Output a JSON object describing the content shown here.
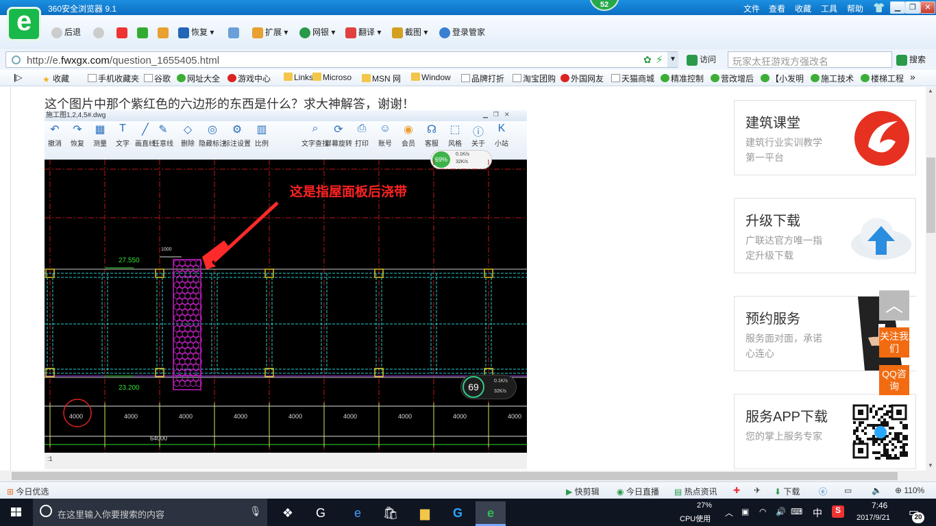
{
  "browser": {
    "title": "360安全浏览器 9.1",
    "tab_badge": "52",
    "menu": [
      "文件",
      "查看",
      "收藏",
      "工具",
      "帮助"
    ],
    "toolbar": {
      "back": "后退",
      "restore": "恢复",
      "extend": "扩展",
      "bank": "网银",
      "translate": "翻译",
      "screenshot": "截图",
      "login": "登录管家"
    },
    "address": {
      "url_prefix": "http://e.",
      "url_domain": "fwxgx.com",
      "url_path": "/question_1655405.html",
      "visit": "访问",
      "search_placeholder": "玩家太狂游戏方强改名",
      "search_btn": "搜索"
    },
    "favorites": [
      "收藏",
      "手机收藏夹",
      "谷歌",
      "网址大全",
      "游戏中心",
      "Links",
      "Microso",
      "MSN 网",
      "Window",
      "品牌打折",
      "淘宝团购",
      "外国网友",
      "天猫商城",
      "精准控制",
      "营改增后",
      "【小发明",
      "施工技术",
      "楼梯工程"
    ]
  },
  "page": {
    "question": "这个图片中那个紫红色的六边形的东西是什么？求大神解答，谢谢！",
    "cad": {
      "window_title": "施工图1,2,4,5#.dwg",
      "tools": [
        "撤消",
        "恢复",
        "测量",
        "文字",
        "画直线",
        "任意线",
        "删除",
        "隐藏标注",
        "标注设置",
        "比例",
        "文字查找",
        "屏幕旋转",
        "打印",
        "账号",
        "会员",
        "客服",
        "风格",
        "关于",
        "小站"
      ],
      "annotation": "这是指屋面板后浇带",
      "elev_top": "27.550",
      "elev_bottom": "23.200",
      "dim_small": "1000",
      "spans": [
        "4000",
        "4000",
        "4000",
        "4000",
        "4000",
        "4000",
        "4000",
        "4000",
        "4000"
      ],
      "total_span": "64000",
      "net_percent_top": "69%",
      "net_up_top": "0.1K/s",
      "net_down_top": "32K/s",
      "net_percent": "69",
      "net_up": "0.1K/s",
      "net_down": "32K/s",
      "status": ":1"
    },
    "sidebar": [
      {
        "title": "建筑课堂",
        "desc": "建筑行业实训教学第一平台"
      },
      {
        "title": "升级下载",
        "desc": "广联达官方唯一指定升级下载"
      },
      {
        "title": "预约服务",
        "desc": "服务面对面，承诺心连心"
      },
      {
        "title": "服务APP下载",
        "desc": "您的掌上服务专家"
      }
    ],
    "float_follow": "关注我们",
    "float_qq": "QQ咨询"
  },
  "statusbar": {
    "left": "今日优选",
    "items": [
      "快剪辑",
      "今日直播",
      "热点资讯",
      "下载"
    ],
    "zoom": "110%"
  },
  "taskbar": {
    "search_placeholder": "在这里输入你要搜索的内容",
    "cpu_percent": "27%",
    "cpu_label": "CPU使用",
    "ime": "中",
    "time": "7:46",
    "date": "2017/9/21",
    "notifications": "20"
  },
  "colors": {
    "accent": "#1c8fe0",
    "orange": "#f26b10",
    "hexagon": "#c020c0",
    "annotation": "#ff2222"
  }
}
